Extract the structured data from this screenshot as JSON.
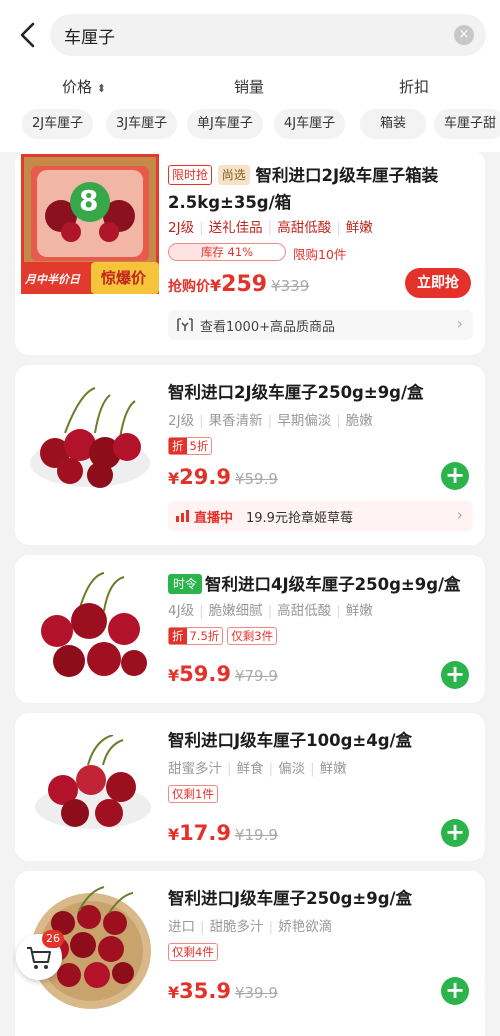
{
  "header": {
    "query": "车厘子"
  },
  "sort_tabs": [
    "价格",
    "销量",
    "折扣"
  ],
  "chips": [
    "2J车厘子",
    "3J车厘子",
    "单J车厘子",
    "4J车厘子",
    "箱装",
    "车厘子甜"
  ],
  "products": [
    {
      "badge_time": "限时抢",
      "badge_pick": "尚选",
      "title": "智利进口2J级车厘子箱装2.5kg±35g/箱",
      "tags": [
        "2J级",
        "送礼佳品",
        "高甜低酸",
        "鲜嫩"
      ],
      "stock_label": "库存 41%",
      "stock_fraction": 0.41,
      "limit": "限购10件",
      "price_label": "抢购价",
      "price": "259",
      "old_price": "¥339",
      "buy_label": "立即抢",
      "more": "查看1000+高品质商品",
      "image_text_number": "8",
      "image_text_banner": "惊爆价",
      "image_text_ribbon": "月中半价日"
    },
    {
      "title": "智利进口2J级车厘子250g±9g/盒",
      "tags": [
        "2J级",
        "果香清新",
        "早期偏淡",
        "脆嫩"
      ],
      "discount_tag": "折",
      "discount_value": "5折",
      "price": "29.9",
      "old_price": "¥59.9",
      "live_label": "直播中",
      "live_text": "19.9元抢章姬草莓"
    },
    {
      "badge_season": "时令",
      "title": "智利进口4J级车厘子250g±9g/盒",
      "tags": [
        "4J级",
        "脆嫩细腻",
        "高甜低酸",
        "鲜嫩"
      ],
      "discount_tag": "折",
      "discount_value": "7.5折",
      "remain": "仅剩3件",
      "price": "59.9",
      "old_price": "¥79.9"
    },
    {
      "title": "智利进口J级车厘子100g±4g/盒",
      "tags": [
        "甜蜜多汁",
        "鲜食",
        "偏淡",
        "鲜嫩"
      ],
      "remain": "仅剩1件",
      "price": "17.9",
      "old_price": "¥19.9"
    },
    {
      "title": "智利进口J级车厘子250g±9g/盒",
      "tags": [
        "进口",
        "甜脆多汁",
        "娇艳欲滴"
      ],
      "remain": "仅剩4件",
      "price": "35.9",
      "old_price": "¥39.9"
    }
  ],
  "cart": {
    "count": "26"
  },
  "colors": {
    "accent_red": "#e4322b",
    "add_green": "#2bb34c",
    "season_green": "#2bb34c"
  },
  "symbols": {
    "yen": "¥",
    "plus": "+",
    "clear": "×",
    "sort_arrow": "⬍",
    "chevron": "›"
  }
}
